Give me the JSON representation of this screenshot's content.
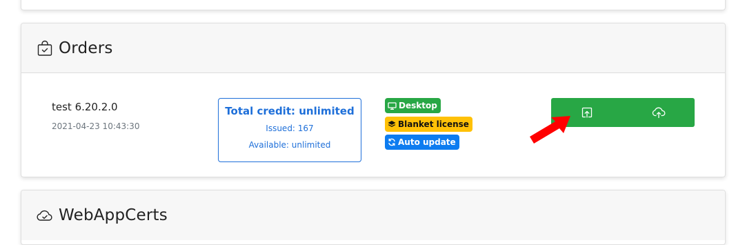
{
  "orders_card": {
    "title": "Orders",
    "title_icon": "shopping-bag-check-icon",
    "order": {
      "name": "test 6.20.2.0",
      "date": "2021-04-23 10:43:30",
      "credit": {
        "total": "Total credit: unlimited",
        "issued": "Issued: 167",
        "available": "Available: unlimited"
      },
      "badges": [
        {
          "label": "Desktop",
          "icon": "monitor-icon",
          "color": "#28a745"
        },
        {
          "label": "Blanket license",
          "icon": "layers-icon",
          "color": "#ffc107"
        },
        {
          "label": "Auto update",
          "icon": "refresh-icon",
          "color": "#0d7cf0"
        }
      ],
      "actions": [
        {
          "icon": "export-upload-icon"
        },
        {
          "icon": "cloud-upload-icon"
        }
      ]
    }
  },
  "webapp_card": {
    "title": "WebAppCerts",
    "title_icon": "cloud-check-icon"
  },
  "annotation": {
    "icon": "red-arrow-icon",
    "color": "#ff0000"
  },
  "colors": {
    "primary": "#1e6fd9",
    "success": "#28a745",
    "warning": "#ffc107",
    "info": "#0d7cf0"
  }
}
